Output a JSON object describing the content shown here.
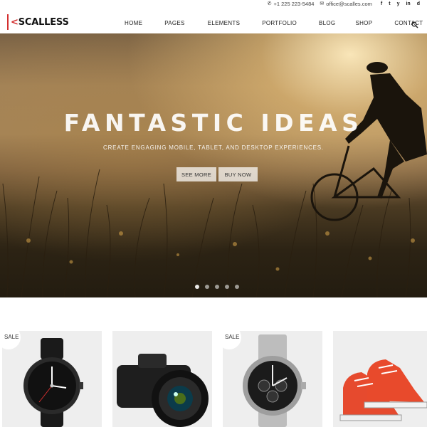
{
  "topbar": {
    "phone": "+1 225 223-5484",
    "email": "office@scalles.com",
    "social": [
      "f",
      "t",
      "y",
      "in",
      "d"
    ]
  },
  "header": {
    "logo_prefix": "<",
    "logo_main": "SCAL",
    "logo_accent": "LESS",
    "nav": [
      "HOME",
      "PAGES",
      "ELEMENTS",
      "PORTFOLIO",
      "BLOG",
      "SHOP",
      "CONTACT"
    ]
  },
  "hero": {
    "title": "FANTASTIC IDEAS",
    "subtitle": "CREATE ENGAGING MOBILE, TABLET, AND DESKTOP EXPERIENCES.",
    "buttons": [
      "SEE MORE",
      "BUY NOW"
    ],
    "slides": 5,
    "active_slide": 1
  },
  "products": {
    "sale_label": "SALE",
    "items": [
      {
        "product": "wristwatch",
        "sale": true
      },
      {
        "product": "camera",
        "sale": false
      },
      {
        "product": "chronograph-watch",
        "sale": true
      },
      {
        "product": "sneakers",
        "sale": false
      }
    ]
  },
  "colors": {
    "accent": "#d32f2f",
    "product_bg": "#eeeeee"
  }
}
